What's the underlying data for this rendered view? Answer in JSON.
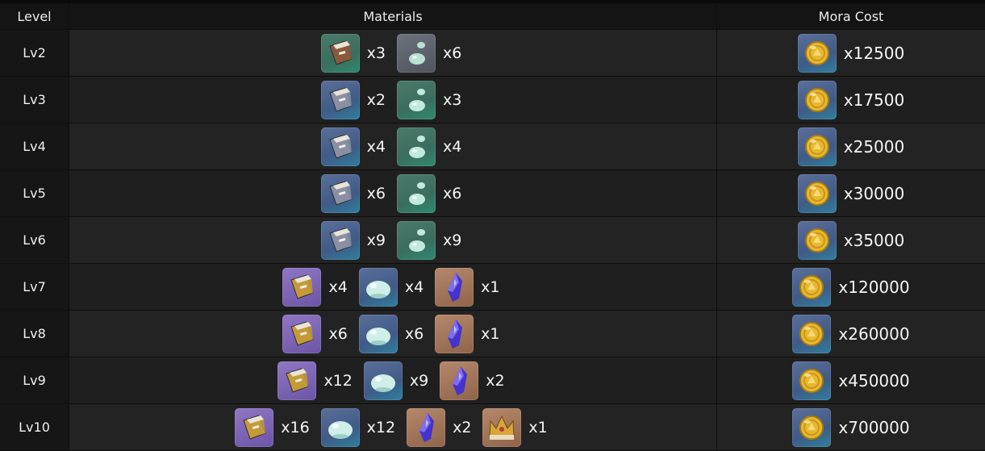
{
  "header": {
    "level": "Level",
    "materials": "Materials",
    "mora": "Mora Cost"
  },
  "icons": {
    "book-green": {
      "bg": "green",
      "kind": "book",
      "main": "#8a5a3c"
    },
    "book-blue": {
      "bg": "blue",
      "kind": "book",
      "main": "#8a8fa3"
    },
    "book-purple": {
      "bg": "purple",
      "kind": "book",
      "main": "#c49a3a"
    },
    "slime-gray": {
      "bg": "gray",
      "kind": "drop",
      "main": "#bfe9d8"
    },
    "slime-green": {
      "bg": "green",
      "kind": "drop",
      "main": "#c8f0e4"
    },
    "slime-blue": {
      "bg": "blue",
      "kind": "slime",
      "main": "#cfeee8"
    },
    "crystal": {
      "bg": "orange",
      "kind": "crystal",
      "main": "#4433cc"
    },
    "crown": {
      "bg": "orange",
      "kind": "crown",
      "main": "#d9a536"
    },
    "mora": {
      "bg": "blue",
      "kind": "coin",
      "main": "#e8b92e"
    }
  },
  "rows": [
    {
      "level": "Lv2",
      "materials": [
        {
          "icon": "book-green",
          "qty": "x3"
        },
        {
          "icon": "slime-gray",
          "qty": "x6"
        }
      ],
      "mora": "x12500"
    },
    {
      "level": "Lv3",
      "materials": [
        {
          "icon": "book-blue",
          "qty": "x2"
        },
        {
          "icon": "slime-green",
          "qty": "x3"
        }
      ],
      "mora": "x17500"
    },
    {
      "level": "Lv4",
      "materials": [
        {
          "icon": "book-blue",
          "qty": "x4"
        },
        {
          "icon": "slime-green",
          "qty": "x4"
        }
      ],
      "mora": "x25000"
    },
    {
      "level": "Lv5",
      "materials": [
        {
          "icon": "book-blue",
          "qty": "x6"
        },
        {
          "icon": "slime-green",
          "qty": "x6"
        }
      ],
      "mora": "x30000"
    },
    {
      "level": "Lv6",
      "materials": [
        {
          "icon": "book-blue",
          "qty": "x9"
        },
        {
          "icon": "slime-green",
          "qty": "x9"
        }
      ],
      "mora": "x35000"
    },
    {
      "level": "Lv7",
      "materials": [
        {
          "icon": "book-purple",
          "qty": "x4"
        },
        {
          "icon": "slime-blue",
          "qty": "x4"
        },
        {
          "icon": "crystal",
          "qty": "x1"
        }
      ],
      "mora": "x120000"
    },
    {
      "level": "Lv8",
      "materials": [
        {
          "icon": "book-purple",
          "qty": "x6"
        },
        {
          "icon": "slime-blue",
          "qty": "x6"
        },
        {
          "icon": "crystal",
          "qty": "x1"
        }
      ],
      "mora": "x260000"
    },
    {
      "level": "Lv9",
      "materials": [
        {
          "icon": "book-purple",
          "qty": "x12"
        },
        {
          "icon": "slime-blue",
          "qty": "x9"
        },
        {
          "icon": "crystal",
          "qty": "x2"
        }
      ],
      "mora": "x450000"
    },
    {
      "level": "Lv10",
      "materials": [
        {
          "icon": "book-purple",
          "qty": "x16"
        },
        {
          "icon": "slime-blue",
          "qty": "x12"
        },
        {
          "icon": "crystal",
          "qty": "x2"
        },
        {
          "icon": "crown",
          "qty": "x1"
        }
      ],
      "mora": "x700000"
    }
  ]
}
